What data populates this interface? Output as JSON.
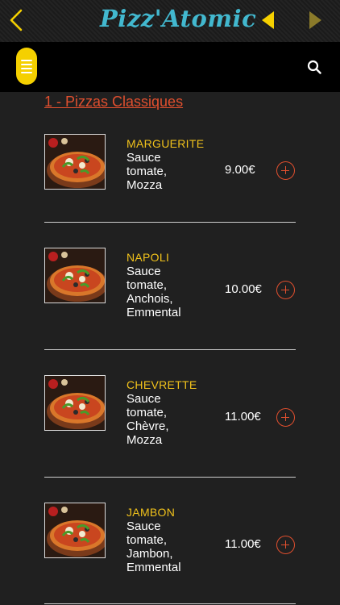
{
  "header": {
    "app_title": "Pizz'Atomic",
    "back_icon": "chevron-left-icon",
    "prev_icon": "triangle-left-icon",
    "next_icon": "triangle-right-icon",
    "title_color": "#42b8cf",
    "prev_color": "#f5d000",
    "next_color": "#8a7a2a"
  },
  "toolbar": {
    "menu_icon": "hamburger-menu-icon",
    "menu_color": "#f5d000",
    "search_icon": "search-icon"
  },
  "section": {
    "title": "1 - Pizzas Classiques",
    "color": "#e04f2e"
  },
  "items": [
    {
      "name": "MARGUERITE",
      "desc_lines": [
        "Sauce",
        "tomate,",
        "Mozza"
      ],
      "price": "9.00€"
    },
    {
      "name": "NAPOLI",
      "desc_lines": [
        "Sauce",
        "tomate,",
        "Anchois,",
        "Emmental"
      ],
      "price": "10.00€"
    },
    {
      "name": "CHEVRETTE",
      "desc_lines": [
        "Sauce",
        "tomate,",
        "Chèvre,",
        "Mozza"
      ],
      "price": "11.00€"
    },
    {
      "name": "JAMBON",
      "desc_lines": [
        "Sauce",
        "tomate,",
        "Jambon,",
        "Emmental"
      ],
      "price": "11.00€"
    }
  ],
  "colors": {
    "item_name": "#f1c21b",
    "accent": "#e04f2e",
    "background": "#202020"
  }
}
